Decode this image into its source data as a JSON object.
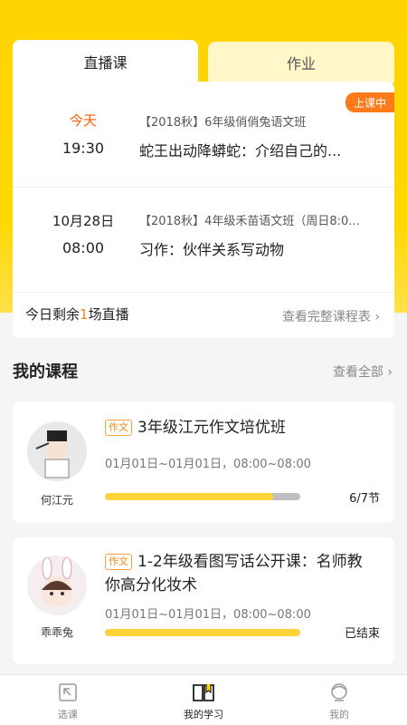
{
  "tabs": [
    {
      "label": "直播课",
      "active": true
    },
    {
      "label": "作业",
      "active": false
    }
  ],
  "live_badge": "上课中",
  "lessons": [
    {
      "date": "今天",
      "time": "19:30",
      "course": "【2018秋】6年级俏俏兔语文班",
      "title": "蛇王出动降蟒蛇：介绍自己的..."
    },
    {
      "date": "10月28日",
      "time": "08:00",
      "course": "【2018秋】4年级禾苗语文班（周日8:0...",
      "title": "习作：伙伴关系写动物"
    }
  ],
  "remain": {
    "prefix": "今日剩余",
    "count": "1",
    "suffix": "场直播"
  },
  "schedule_link": "查看完整课程表",
  "my_courses": {
    "title": "我的课程",
    "see_all": "查看全部"
  },
  "courses": [
    {
      "tag": "作文",
      "title": "3年级江元作文培优班",
      "dates": "01月01日~01月01日，08:00~08:00",
      "teacher": "何江元",
      "status": "6/7节",
      "progress": 0.86
    },
    {
      "tag": "作文",
      "title": "1-2年级看图写话公开课：名师教你高分化妆术",
      "dates": "01月01日~01月01日，08:00~08:00",
      "teacher": "乖乖兔",
      "status": "已结束",
      "progress": 1.0
    }
  ],
  "tabbar": [
    {
      "label": "选课",
      "icon": "course-select-icon"
    },
    {
      "label": "我的学习",
      "icon": "my-study-icon",
      "active": true
    },
    {
      "label": "我的",
      "icon": "profile-icon"
    }
  ],
  "colors": {
    "accent": "#ffd400",
    "live": "#ff7a1a",
    "today": "#ff5b00"
  }
}
